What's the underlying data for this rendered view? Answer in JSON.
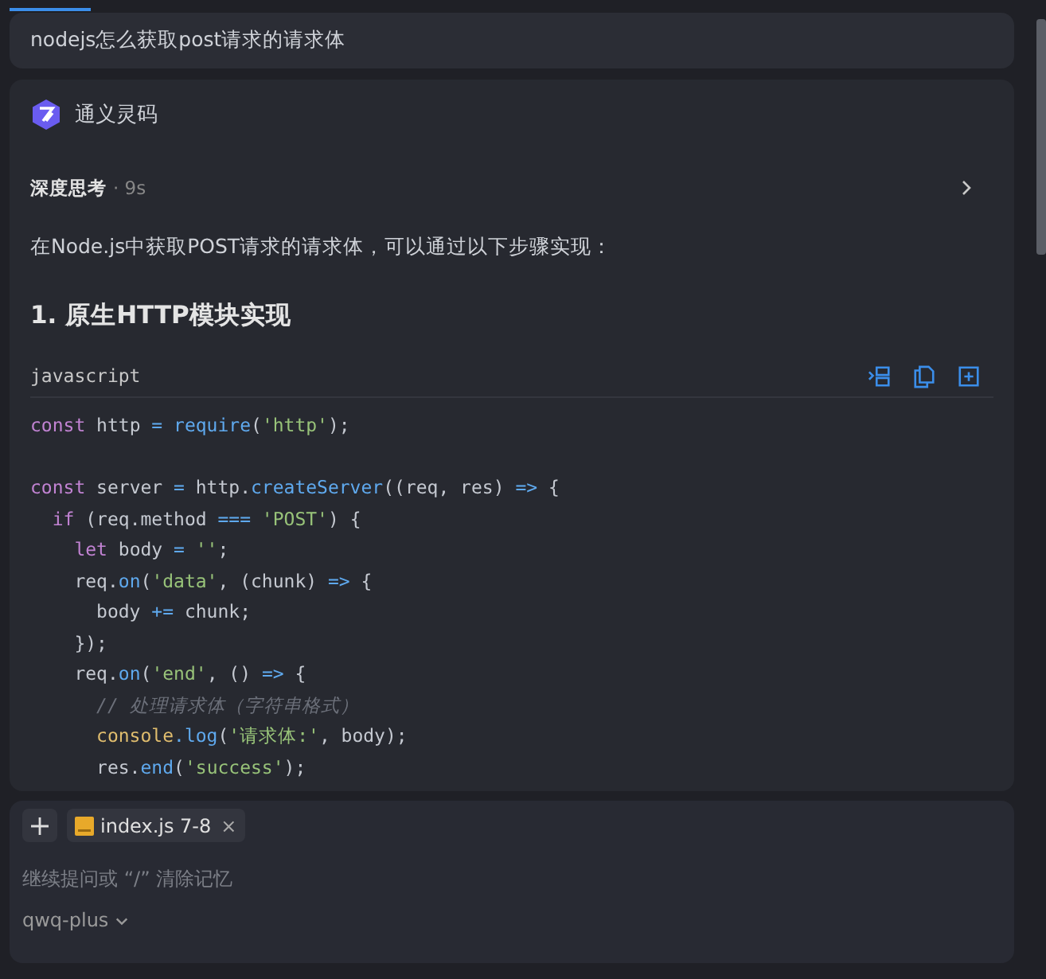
{
  "user_message": {
    "text": "nodejs怎么获取post请求的请求体"
  },
  "assistant": {
    "name": "通义灵码",
    "thinking": {
      "label": "深度思考",
      "duration": "· 9s",
      "expanded": false
    },
    "intro": "在Node.js中获取POST请求的请求体，可以通过以下步骤实现：",
    "heading": "1. 原生HTTP模块实现",
    "code_block": {
      "language": "javascript",
      "lines": [
        {
          "kind": "code",
          "tokens": [
            {
              "text": "const",
              "kind": "keyword"
            },
            {
              "text": " http ",
              "kind": "plain"
            },
            {
              "text": "=",
              "kind": "operator"
            },
            {
              "text": " require",
              "kind": "function"
            },
            {
              "text": "(",
              "kind": "plain"
            },
            {
              "text": "'http'",
              "kind": "string"
            },
            {
              "text": ");",
              "kind": "plain"
            }
          ]
        },
        {
          "kind": "blank"
        },
        {
          "kind": "code",
          "tokens": [
            {
              "text": "const",
              "kind": "keyword"
            },
            {
              "text": " server ",
              "kind": "plain"
            },
            {
              "text": "=",
              "kind": "operator"
            },
            {
              "text": " http.",
              "kind": "plain"
            },
            {
              "text": "createServer",
              "kind": "function"
            },
            {
              "text": "((req, res) ",
              "kind": "plain"
            },
            {
              "text": "=>",
              "kind": "operator"
            },
            {
              "text": " {",
              "kind": "plain"
            }
          ]
        },
        {
          "kind": "code",
          "tokens": [
            {
              "text": "  if",
              "kind": "keyword"
            },
            {
              "text": " (req.method ",
              "kind": "plain"
            },
            {
              "text": "===",
              "kind": "operator"
            },
            {
              "text": " 'POST'",
              "kind": "string"
            },
            {
              "text": ") {",
              "kind": "plain"
            }
          ]
        },
        {
          "kind": "code",
          "tokens": [
            {
              "text": "    let",
              "kind": "keyword"
            },
            {
              "text": " body ",
              "kind": "plain"
            },
            {
              "text": "=",
              "kind": "operator"
            },
            {
              "text": " ''",
              "kind": "string"
            },
            {
              "text": ";",
              "kind": "plain"
            }
          ]
        },
        {
          "kind": "code",
          "tokens": [
            {
              "text": "    req.",
              "kind": "plain"
            },
            {
              "text": "on",
              "kind": "function"
            },
            {
              "text": "(",
              "kind": "plain"
            },
            {
              "text": "'data'",
              "kind": "string"
            },
            {
              "text": ", (chunk) ",
              "kind": "plain"
            },
            {
              "text": "=>",
              "kind": "operator"
            },
            {
              "text": " {",
              "kind": "plain"
            }
          ]
        },
        {
          "kind": "code",
          "tokens": [
            {
              "text": "      body ",
              "kind": "plain"
            },
            {
              "text": "+=",
              "kind": "operator"
            },
            {
              "text": " chunk;",
              "kind": "plain"
            }
          ]
        },
        {
          "kind": "code",
          "tokens": [
            {
              "text": "    });",
              "kind": "plain"
            }
          ]
        },
        {
          "kind": "code",
          "tokens": [
            {
              "text": "    req.",
              "kind": "plain"
            },
            {
              "text": "on",
              "kind": "function"
            },
            {
              "text": "(",
              "kind": "plain"
            },
            {
              "text": "'end'",
              "kind": "string"
            },
            {
              "text": ", () ",
              "kind": "plain"
            },
            {
              "text": "=>",
              "kind": "operator"
            },
            {
              "text": " {",
              "kind": "plain"
            }
          ]
        },
        {
          "kind": "code",
          "tokens": [
            {
              "text": "      // 处理请求体（字符串格式）",
              "kind": "comment"
            }
          ]
        },
        {
          "kind": "code",
          "tokens": [
            {
              "text": "      console",
              "kind": "object"
            },
            {
              "text": ".log",
              "kind": "function"
            },
            {
              "text": "(",
              "kind": "plain"
            },
            {
              "text": "'请求体:'",
              "kind": "string"
            },
            {
              "text": ", body);",
              "kind": "plain"
            }
          ]
        },
        {
          "kind": "code",
          "tokens": [
            {
              "text": "      res.",
              "kind": "plain"
            },
            {
              "text": "end",
              "kind": "function"
            },
            {
              "text": "(",
              "kind": "plain"
            },
            {
              "text": "'success'",
              "kind": "string"
            },
            {
              "text": ");",
              "kind": "plain"
            }
          ]
        }
      ]
    }
  },
  "composer": {
    "context_chip": {
      "file": "index.js 7-8",
      "remove": "×"
    },
    "placeholder": "继续提问或 “/” 清除记忆",
    "model": "qwq-plus"
  }
}
